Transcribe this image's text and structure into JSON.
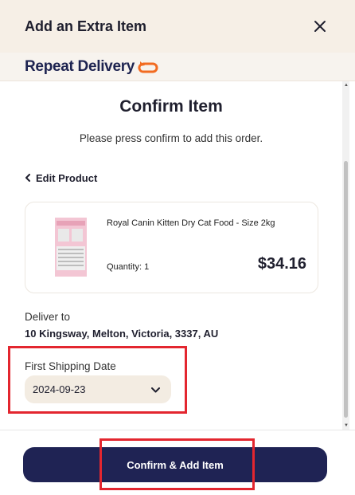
{
  "header": {
    "title": "Add an Extra Item",
    "close_icon": "close-icon"
  },
  "brand": {
    "text": "Repeat Delivery",
    "icon": "repeat-arrow-icon",
    "icon_color": "#f26b21"
  },
  "confirm": {
    "title": "Confirm Item",
    "subtitle": "Please press confirm to add this order."
  },
  "edit_product": {
    "label": "Edit Product",
    "icon": "chevron-left-icon"
  },
  "product": {
    "name": "Royal Canin Kitten Dry Cat Food - Size 2kg",
    "quantity": "Quantity: 1",
    "price": "$34.16",
    "image_icon": "product-image"
  },
  "delivery": {
    "label": "Deliver to",
    "address": "10 Kingsway, Melton, Victoria, 3337, AU"
  },
  "shipping": {
    "label": "First Shipping Date",
    "selected": "2024-09-23",
    "dropdown_icon": "chevron-down-icon"
  },
  "footer": {
    "confirm_button": "Confirm & Add Item"
  },
  "colors": {
    "primary": "#1f2354",
    "highlight": "#e3262f",
    "header_bg": "#f6efe6",
    "select_bg": "#f3ece2"
  }
}
